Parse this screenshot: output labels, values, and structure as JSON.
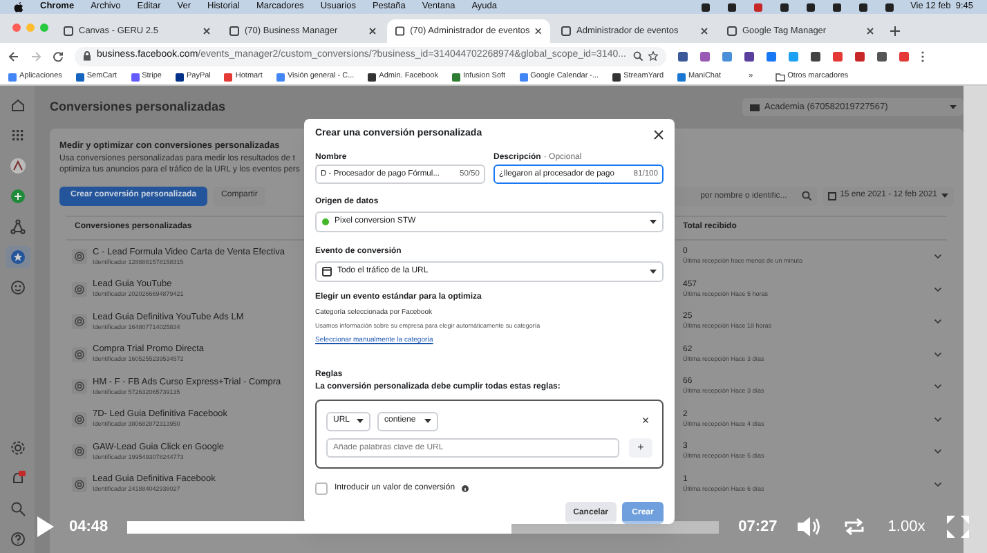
{
  "menubar": {
    "app": "Chrome",
    "menus": [
      "Archivo",
      "Editar",
      "Ver",
      "Historial",
      "Marcadores",
      "Usuarios",
      "Pestaña",
      "Ventana",
      "Ayuda"
    ],
    "clock": "Vie 12 feb  9:45"
  },
  "tabs": [
    {
      "title": "Canvas - GERU 2.5",
      "selected": false
    },
    {
      "title": "(70) Business Manager",
      "selected": false
    },
    {
      "title": "(70) Administrador de eventos",
      "selected": true
    },
    {
      "title": "Administrador de eventos",
      "selected": false
    },
    {
      "title": "Google Tag Manager",
      "selected": false
    }
  ],
  "address_bar": {
    "url_host": "business.facebook.com",
    "url_path": "/events_manager2/custom_conversions/?business_id=314044702268974&global_scope_id=3140..."
  },
  "bookmarks": [
    "Aplicaciones",
    "SemCart",
    "Stripe",
    "PayPal",
    "Hotmart",
    "Visión general - C...",
    "Admin. Facebook",
    "Infusion Soft",
    "Google Calendar -...",
    "StreamYard",
    "ManiChat"
  ],
  "bookmarks_more": "»",
  "other_bookmarks": "Otros marcadores",
  "sidebar": {
    "top_items": [
      {
        "kind": "home",
        "selected": false
      },
      {
        "kind": "grid",
        "selected": false
      },
      {
        "kind": "logo",
        "selected": false
      },
      {
        "kind": "add",
        "selected": false
      },
      {
        "kind": "graph",
        "selected": false
      },
      {
        "kind": "star",
        "selected": true
      },
      {
        "kind": "face",
        "selected": false
      }
    ],
    "bottom_items": [
      {
        "kind": "settings",
        "selected": false
      },
      {
        "kind": "alerts",
        "selected": false
      },
      {
        "kind": "search",
        "selected": false
      },
      {
        "kind": "help",
        "selected": false
      }
    ]
  },
  "page": {
    "title": "Conversiones personalizadas",
    "account": "Academia (670582019727567)"
  },
  "card": {
    "heading": "Medir y optimizar con conversiones personalizadas",
    "description": [
      "Usa conversiones personalizadas para medir los resultados de t",
      "optimiza tus anuncios para el tráfico de la URL y los eventos pers"
    ],
    "create_button": "Crear conversión personalizada",
    "share_button": "Compartir",
    "search": {
      "placeholder": "por nombre o identific..."
    },
    "date_range": "15 ene 2021 - 12 feb 2021"
  },
  "table": {
    "columns": [
      "Conversiones personalizadas",
      "Total recibido"
    ],
    "rows": [
      {
        "name": "C - Lead Formula Video Carta de Venta Efectiva",
        "id": "Identificador 1288881578158315",
        "total": "0",
        "last_received": "Última recepción hace menos de un minuto"
      },
      {
        "name": "Lead Guia YouTube",
        "id": "Identificador 2020266694879421",
        "total": "457",
        "last_received": "Última recepción Hace 5 horas"
      },
      {
        "name": "Lead Guia Definitiva YouTube Ads LM",
        "id": "Identificador 164807714025834",
        "total": "25",
        "last_received": "Última recepción Hace 18 horas"
      },
      {
        "name": "Compra Trial Promo Directa",
        "id": "Identificador 1605255239534572",
        "total": "62",
        "last_received": "Última recepción Hace 3 días"
      },
      {
        "name": "HM - F - FB Ads Curso Express+Trial - Compra",
        "id": "Identificador 572632065739135",
        "total": "66",
        "last_received": "Última recepción Hace 3 días"
      },
      {
        "name": "7D- Led Guia Definitiva Facebook",
        "id": "Identificador 380682872313950",
        "total": "2",
        "last_received": "Última recepción Hace 4 días"
      },
      {
        "name": "GAW-Lead Guia Click en Google",
        "id": "Identificador 1995493078244773",
        "total": "3",
        "last_received": "Última recepción Hace 5 días"
      },
      {
        "name": "Lead Guia Definitiva Facebook",
        "id": "Identificador 241884042938027",
        "total": "1",
        "last_received": "Última recepción Hace 6 días"
      }
    ]
  },
  "dialog": {
    "title": "Crear una conversión personalizada",
    "name_field": {
      "label": "Nombre",
      "value": "D - Procesador de pago Fórmul...",
      "counter": "50/50",
      "focused": false
    },
    "description_field": {
      "label": "Descripción",
      "optional": "· Opcional",
      "value": "¿llegaron al procesador de pago",
      "counter": "81/100",
      "focused": true
    },
    "data_source": {
      "label": "Origen de datos",
      "value": "Pixel conversion STW",
      "color": "#42b72a"
    },
    "event": {
      "label": "Evento de conversión",
      "value": "Todo el tráfico de la URL"
    },
    "standard_event": {
      "heading": "Elegir un evento estándar para la optimiza",
      "subheading": "Categoría seleccionada por Facebook",
      "text": "Usamos información sobre su empresa para elegir automáticamente su categoría",
      "link": "Seleccionar manualmente la categoría"
    },
    "rules": {
      "label": "Reglas",
      "text": "La conversión personalizada debe cumplir todas estas reglas:",
      "field": "URL",
      "operator": "contiene",
      "placeholder": "Añade palabras clave de URL",
      "add": "+",
      "remove": "×"
    },
    "value_checkbox": {
      "label": "Introducir un valor de conversión",
      "checked": false
    },
    "cancel": "Cancelar",
    "create": {
      "label": "Crear",
      "disabled": true
    }
  },
  "video_player": {
    "elapsed": "04:48",
    "level": 0.65,
    "duration": "07:27",
    "speed": "1.00x"
  }
}
